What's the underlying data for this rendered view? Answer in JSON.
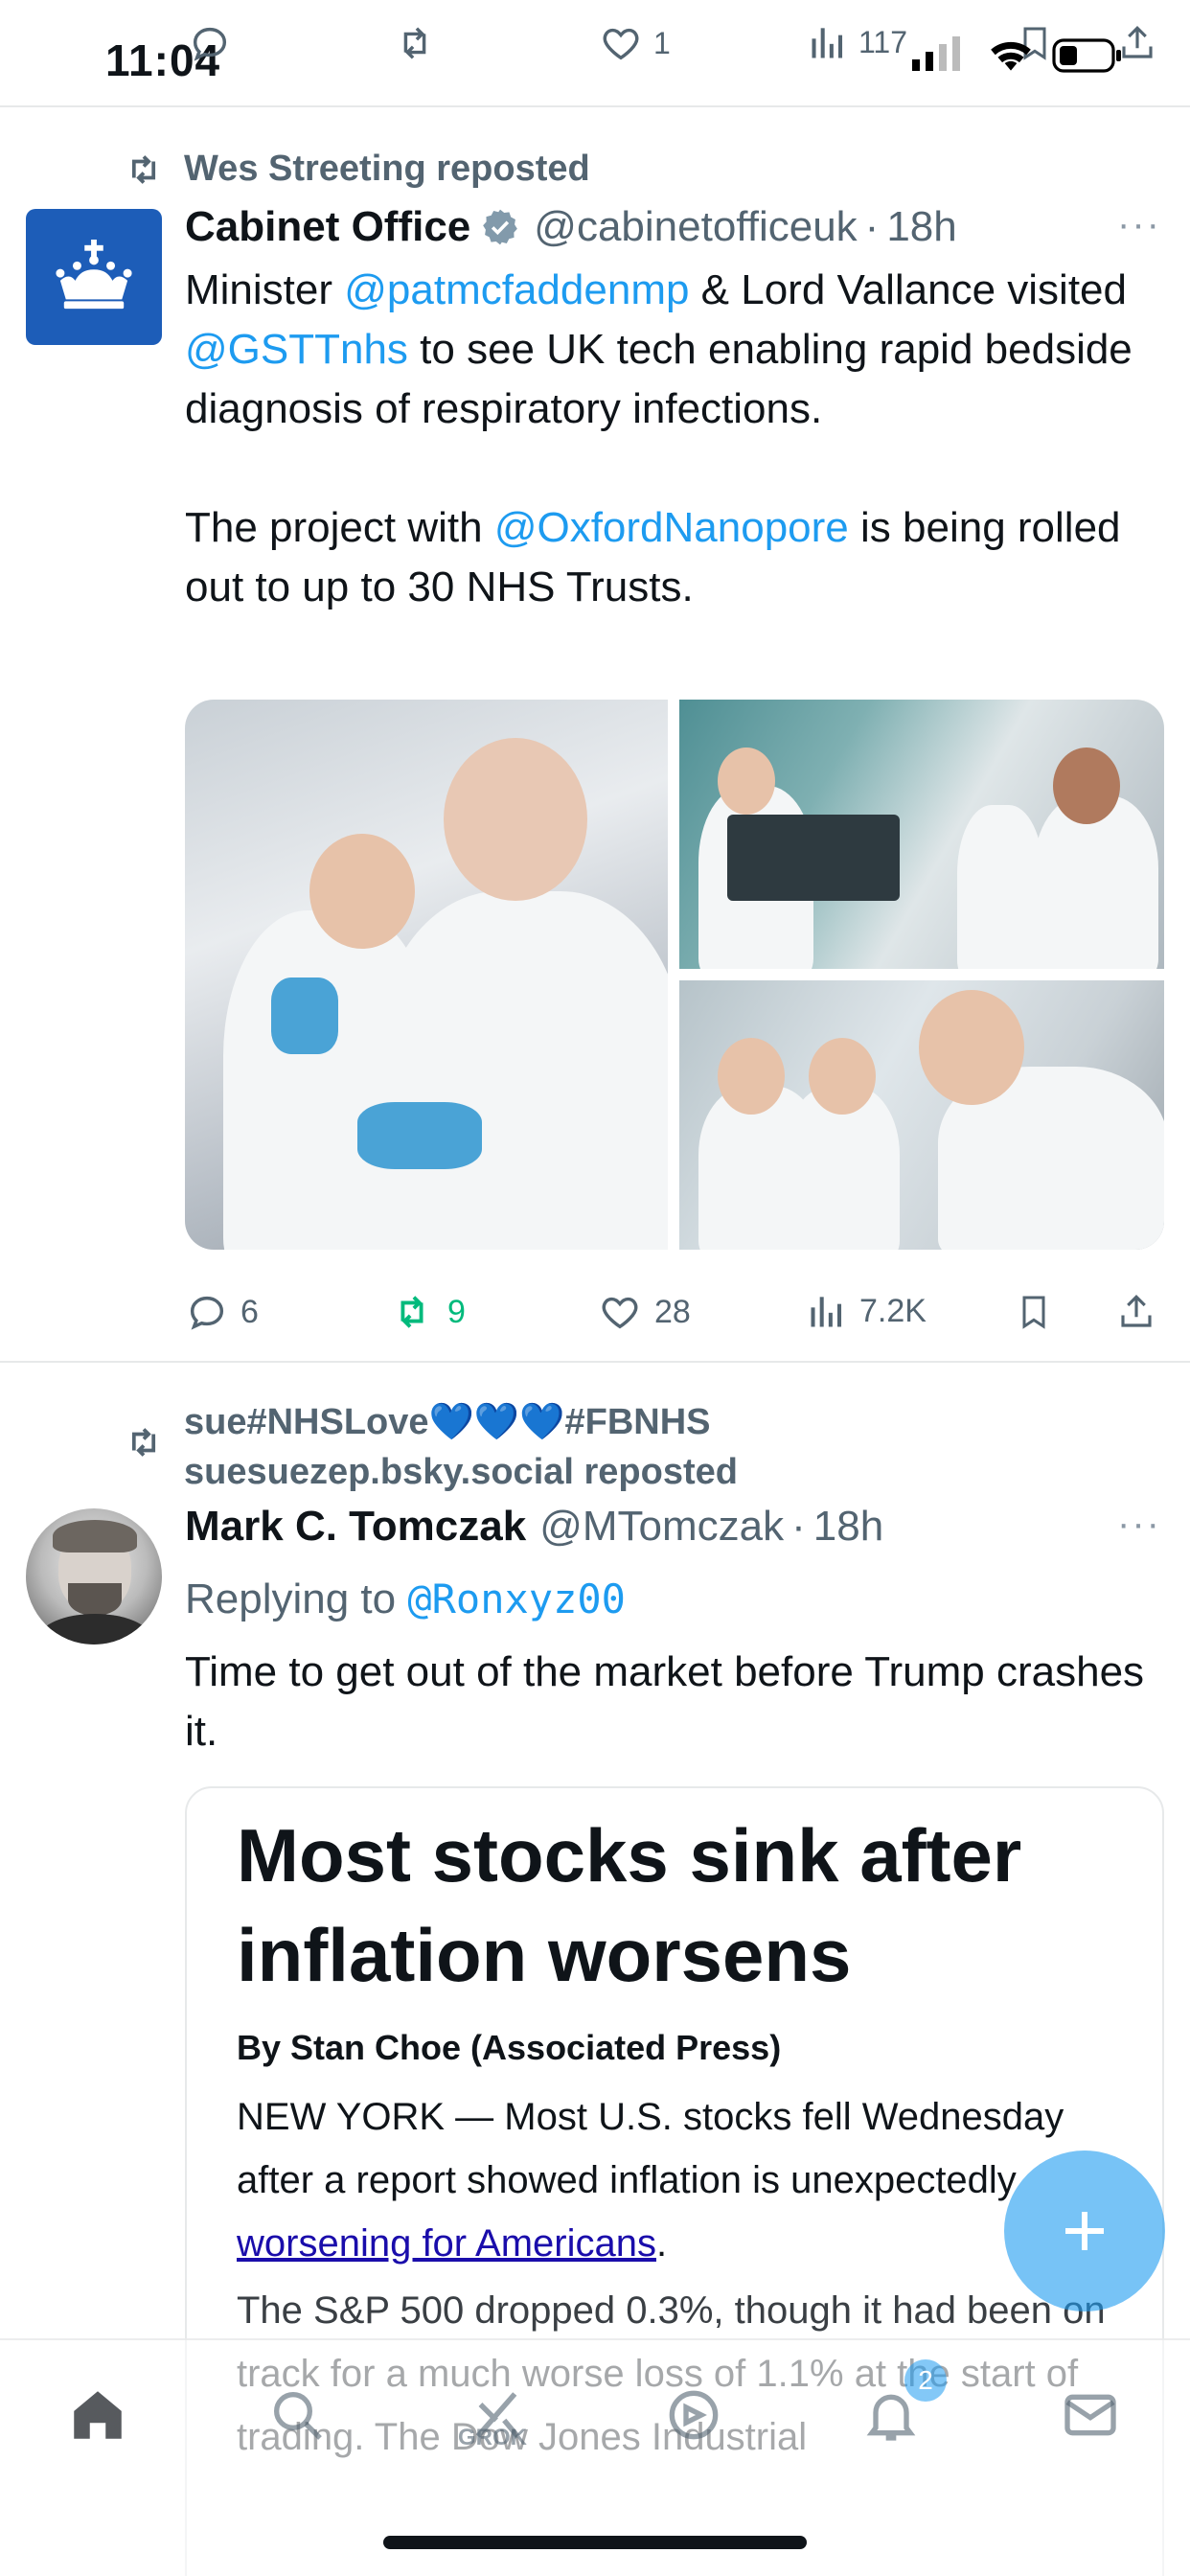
{
  "status_bar": {
    "time": "11:04"
  },
  "top_actions": {
    "reply_count": "",
    "retweet_count": "",
    "like_count": "1",
    "view_count": "117"
  },
  "tweet1": {
    "reposted_by": "Wes Streeting reposted",
    "author_name": "Cabinet Office",
    "author_handle": "@cabinetofficeuk",
    "separator": "·",
    "time": "18h",
    "text_part1": "Minister ",
    "mention1": "@patmcfaddenmp",
    "text_part2": " & Lord Vallance visited ",
    "mention2": "@GSTTnhs",
    "text_part3": " to see UK tech enabling rapid bedside diagnosis of respiratory infections.",
    "text_part4": "The project with ",
    "mention3": "@OxfordNanopore",
    "text_part5": " is being rolled out to up to 30 NHS Trusts.",
    "replies": "6",
    "retweets": "9",
    "likes": "28",
    "views": "7.2K"
  },
  "tweet2": {
    "reposted_by_line1": "sue#NHSLove💙💙💙#FBNHS",
    "reposted_by_line2": "suesuezep.bsky.social reposted",
    "author_name": "Mark C. Tomczak",
    "author_handle": "@MTomczak",
    "separator": "·",
    "time": "18h",
    "replying_prefix": "Replying to ",
    "replying_to": "@Ronxyz00",
    "text": "Time to get out of the market before Trump crashes it.",
    "card": {
      "title": "Most stocks sink after inflation worsens",
      "byline": "By Stan Choe (Associated Press)",
      "para1_text": "NEW YORK — Most U.S. stocks fell Wednesday after a report showed inflation is unexpectedly ",
      "para1_link": "worsening for Americans",
      "para1_end": ".",
      "para2_text": "The S&P 500 dropped 0.3%, though it had been on track for a much worse loss of 1.1% at the start of trading. The Dow Jones Industrial"
    }
  },
  "tabbar": {
    "grok_label": "GROK",
    "notification_badge": "2"
  },
  "colors": {
    "accent": "#1d9bf0",
    "retweet_green": "#00ba7c",
    "muted": "#536471",
    "cabinet_blue": "#1d5db8"
  }
}
